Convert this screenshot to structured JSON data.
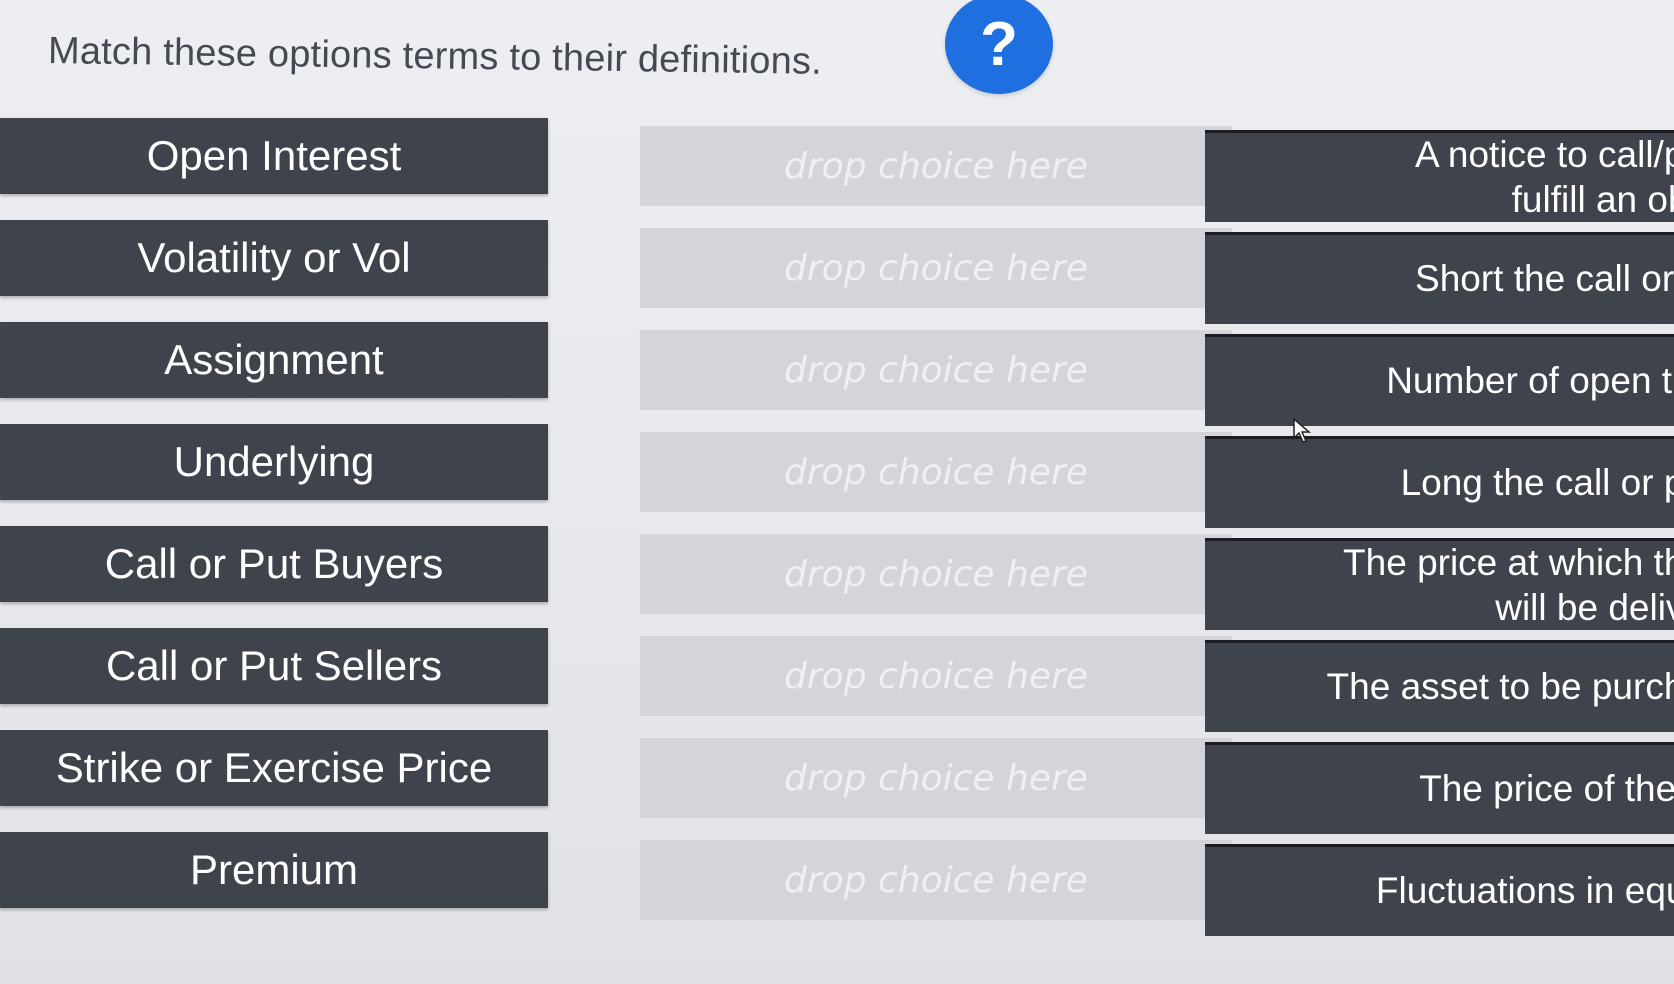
{
  "prompt": "Match these options terms to their definitions.",
  "help_label": "?",
  "terms": [
    "Open Interest",
    "Volatility or Vol",
    "Assignment",
    "Underlying",
    "Call or Put Buyers",
    "Call or Put Sellers",
    "Strike or Exercise Price",
    "Premium"
  ],
  "drop_placeholder": "drop choice here",
  "drop_zones": [
    "drop choice here",
    "drop choice here",
    "drop choice here",
    "drop choice here",
    "drop choice here",
    "drop choice here",
    "drop choice here",
    "drop choice here"
  ],
  "definitions": [
    "A notice to call/pu\nfulfill an obli",
    "Short the call or p",
    "Number of open tra",
    "Long the call or pu",
    "The price at which the\nwill be delive",
    "The asset to be purcha",
    "The price of the c",
    "Fluctuations in equit"
  ]
}
